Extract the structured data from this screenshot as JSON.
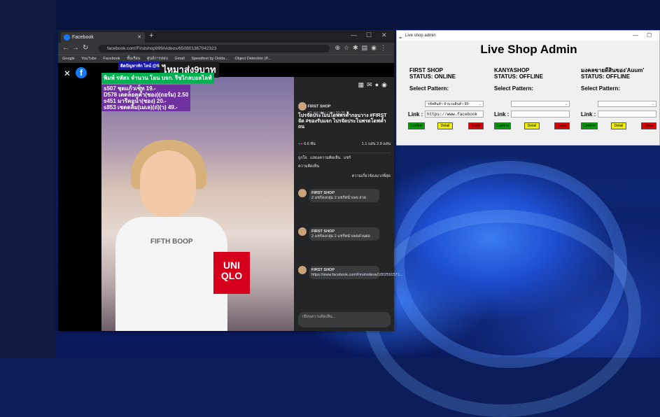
{
  "browser": {
    "tab_title": "Facebook",
    "url": "facebook.com/Firstshop999/videos/650801367042323",
    "bookmarks": [
      "Google",
      "YouTube",
      "Facebook",
      "ชั้นเรียน",
      "ศูนย์การสอบ",
      "Gmail",
      "Speedtest by Ookla...",
      "Object Detection (P..."
    ]
  },
  "video": {
    "overlay_small": "ติดปัญหาทัก ไลน์ @first888",
    "overlay_big": "ไหมาส่ง9บาท",
    "overlay_green": "พิมพ์ รหัสx จำนวน โอน บจก. รีชไกลบอลไลฟ์",
    "overlay_codes": [
      "s507 ชุดแก้วเซ็ท 19.-",
      "D578 เดดล็อคค้ำ(ชอง)(ถอร์ม) 2.50",
      "s451 มารีคอน้ำ(ชอง) 20.-",
      "s853 เชตตลิ้ม(เมเล)(ถ่)(ว) 49.-"
    ],
    "shirt_text": "FIFTH BOOP",
    "bag_text": "UNI QLO"
  },
  "sidebar": {
    "page_name": "FIRST SHOP",
    "post_meta": "22 ตุลาคม เวลา 20:26 น.",
    "post_title": "โปรจัดประโมนโดฟพรค้ำกอนวาง #FIRST จัด #ของรับแจก ไปรจัดประโนพรดโดฟค้ำถน",
    "reaction_count": "6.6 พัน",
    "share_stats": "1.1 แสน  2.9 แสน",
    "like_label": "ถูกใจ",
    "comment_label": "แสดงความคิดเห็น",
    "share_label": "แชร์",
    "comments_tab": "ความคิดเห็น",
    "sort_label": "ความเกี่ยวข้องมากที่สุด",
    "comments": [
      {
        "author": "FIRST SHOP",
        "text": "2 แชร์ลงกลุ่ม 2 แชร์หน้าเพจ สวย"
      },
      {
        "author": "FIRST SHOP",
        "text": "2 แชร์ลงกลุ่ม 2 แชร์หน้าเพจส่วนตอ"
      },
      {
        "author": "FIRST SHOP",
        "text": "https://www.facebook.com/First/videos/1002591571..."
      }
    ],
    "write_placeholder": "เขียนความคิดเห็น..."
  },
  "admin": {
    "window_title": "Live shop admin",
    "title": "Live Shop Admin",
    "select_pattern_label": "Select Pattern:",
    "link_label": "Link :",
    "buttons": {
      "green": "Confirm",
      "yellow": "Detail",
      "red": "Close"
    },
    "shops": [
      {
        "name": "FIRST SHOP",
        "status": "STATUS: ONLINE",
        "pattern": "รหัสสินค้า จำนวนสินค้า 99-",
        "link": "https://www.facebook"
      },
      {
        "name": "KANYASHOP",
        "status": "STATUS: OFFLINE",
        "pattern": "",
        "link": ""
      },
      {
        "name": "มงคลขายดีสินของ'Auum'",
        "status": "STATUS: OFFLINE",
        "pattern": "",
        "link": ""
      }
    ]
  }
}
